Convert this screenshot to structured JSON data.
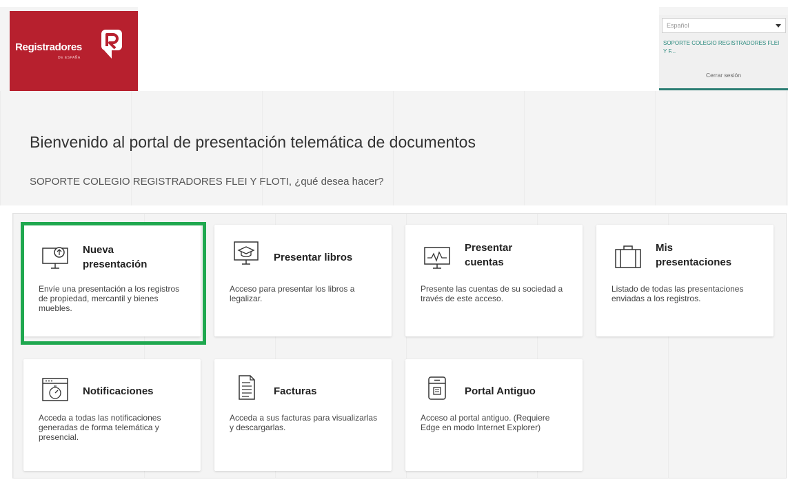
{
  "header": {
    "logo_text": "Registradores",
    "logo_sub": "DE ESPAÑA",
    "language": "Español",
    "user_name": "SOPORTE COLEGIO REGISTRADORES FLEI Y F...",
    "logout": "Cerrar sesión"
  },
  "welcome": {
    "title": "Bienvenido al portal de presentación telemática de documentos",
    "question": "SOPORTE COLEGIO REGISTRADORES FLEI Y FLOTI, ¿qué desea hacer?"
  },
  "cards": [
    {
      "icon": "monitor-upload-icon",
      "title_1": "Nueva",
      "title_2": "presentación",
      "desc": "Envíe una presentación a los registros de propiedad, mercantil y bienes muebles."
    },
    {
      "icon": "monitor-graduation-icon",
      "title_1": "Presentar libros",
      "title_2": "",
      "desc": "Acceso para presentar los libros a legalizar."
    },
    {
      "icon": "monitor-chart-icon",
      "title_1": "Presentar",
      "title_2": "cuentas",
      "desc": "Presente las cuentas de su sociedad a través de este acceso."
    },
    {
      "icon": "briefcase-icon",
      "title_1": "Mis",
      "title_2": "presentaciones",
      "desc": "Listado de todas las presentaciones enviadas a los registros."
    },
    {
      "icon": "window-timer-icon",
      "title_1": "Notificaciones",
      "title_2": "",
      "desc": "Acceda a todas las notificaciones generadas de forma telemática y presencial."
    },
    {
      "icon": "document-icon",
      "title_1": "Facturas",
      "title_2": "",
      "desc": "Acceda a sus facturas para visualizarlas y descargarlas."
    },
    {
      "icon": "archive-icon",
      "title_1": "Portal Antiguo",
      "title_2": "",
      "desc": "Acceso al portal antiguo. (Requiere Edge en modo Internet Explorer)"
    }
  ],
  "colors": {
    "brand": "#b7202e",
    "accent": "#2b7d73",
    "highlight": "#1fa84f"
  }
}
